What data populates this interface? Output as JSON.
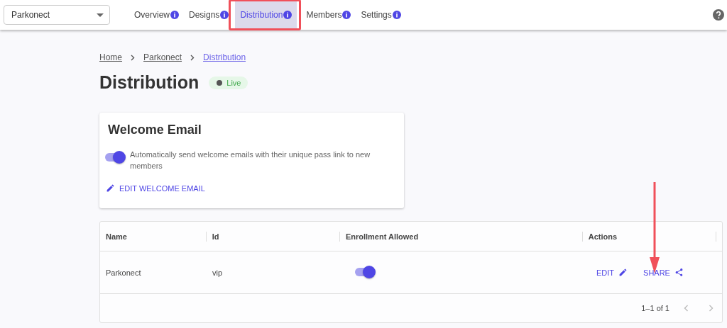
{
  "app_selector": {
    "value": "Parkonect"
  },
  "tabs": [
    {
      "label": "Overview",
      "selected": false
    },
    {
      "label": "Designs",
      "selected": false
    },
    {
      "label": "Distribution",
      "selected": true
    },
    {
      "label": "Members",
      "selected": false
    },
    {
      "label": "Settings",
      "selected": false
    }
  ],
  "breadcrumb": [
    {
      "label": "Home",
      "current": false
    },
    {
      "label": "Parkonect",
      "current": false
    },
    {
      "label": "Distribution",
      "current": true
    }
  ],
  "page_title": "Distribution",
  "status_badge": {
    "label": "Live"
  },
  "welcome_email": {
    "title": "Welcome Email",
    "description": "Automatically send welcome emails with their unique pass link to new members",
    "on": true,
    "action": "EDIT WELCOME EMAIL"
  },
  "table": {
    "columns": [
      "Name",
      "Id",
      "Enrollment Allowed",
      "Actions"
    ],
    "rows": [
      {
        "name": "Parkonect",
        "id": "vip",
        "enrollment_allowed": true,
        "actions": [
          "EDIT",
          "SHARE"
        ]
      }
    ],
    "pagination": "1–1 of 1"
  }
}
